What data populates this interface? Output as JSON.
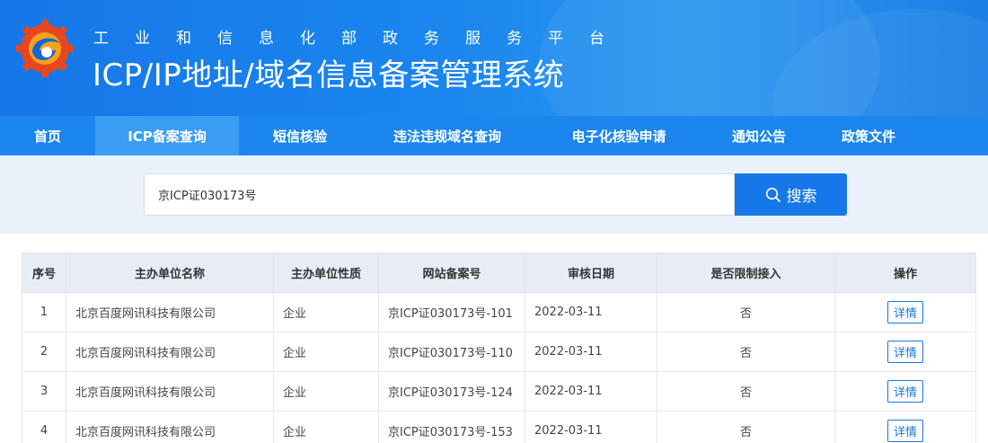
{
  "header": {
    "subtitle": "工业和信息化部政务服务平台",
    "title": "ICP/IP地址/域名信息备案管理系统"
  },
  "nav": {
    "items": [
      {
        "label": "首页",
        "active": false
      },
      {
        "label": "ICP备案查询",
        "active": true
      },
      {
        "label": "短信核验",
        "active": false
      },
      {
        "label": "违法违规域名查询",
        "active": false
      },
      {
        "label": "电子化核验申请",
        "active": false
      },
      {
        "label": "通知公告",
        "active": false
      },
      {
        "label": "政策文件",
        "active": false
      }
    ]
  },
  "search": {
    "value": "京ICP证030173号",
    "button_label": "搜索",
    "icon": "search-icon"
  },
  "table": {
    "headers": [
      "序号",
      "主办单位名称",
      "主办单位性质",
      "网站备案号",
      "审核日期",
      "是否限制接入",
      "操作"
    ],
    "rows": [
      {
        "index": "1",
        "name": "北京百度网讯科技有限公司",
        "type": "企业",
        "record": "京ICP证030173号-101",
        "date": "2022-03-11",
        "restricted": "否",
        "action": "详情"
      },
      {
        "index": "2",
        "name": "北京百度网讯科技有限公司",
        "type": "企业",
        "record": "京ICP证030173号-110",
        "date": "2022-03-11",
        "restricted": "否",
        "action": "详情"
      },
      {
        "index": "3",
        "name": "北京百度网讯科技有限公司",
        "type": "企业",
        "record": "京ICP证030173号-124",
        "date": "2022-03-11",
        "restricted": "否",
        "action": "详情"
      },
      {
        "index": "4",
        "name": "北京百度网讯科技有限公司",
        "type": "企业",
        "record": "京ICP证030173号-153",
        "date": "2022-03-11",
        "restricted": "否",
        "action": "详情"
      }
    ]
  },
  "colors": {
    "primary": "#1677e8",
    "nav_bg": "#1b86ee",
    "nav_active": "#3b9cf4",
    "search_band": "#e9f2fb",
    "table_header": "#e8edf5"
  }
}
